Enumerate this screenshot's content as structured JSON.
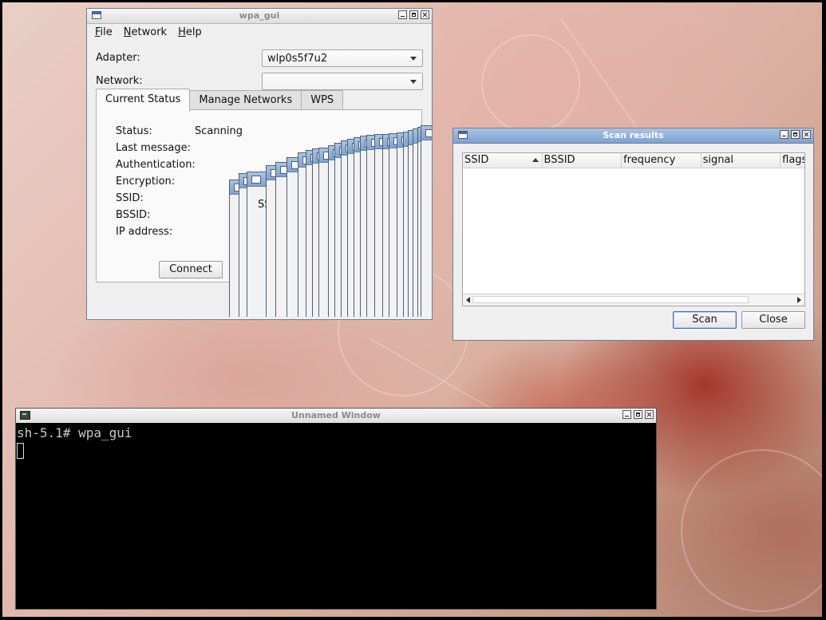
{
  "wpa_gui": {
    "title": "wpa_gui",
    "menu": [
      "File",
      "Network",
      "Help"
    ],
    "adapter_label": "Adapter:",
    "adapter_value": "wlp0s5f7u2",
    "network_label": "Network:",
    "network_value": "",
    "tabs": [
      "Current Status",
      "Manage Networks",
      "WPS"
    ],
    "status_fields": [
      {
        "label": "Status:",
        "value": "Scanning"
      },
      {
        "label": "Last message:",
        "value": ""
      },
      {
        "label": "Authentication:",
        "value": ""
      },
      {
        "label": "Encryption:",
        "value": ""
      },
      {
        "label": "SSID:",
        "value": ""
      },
      {
        "label": "BSSID:",
        "value": ""
      },
      {
        "label": "IP address:",
        "value": ""
      }
    ],
    "connect_label": "Connect",
    "cascade_fragment_text": "SS"
  },
  "scan_results": {
    "title": "Scan results",
    "columns": [
      "SSID",
      "BSSID",
      "frequency",
      "signal",
      "flags"
    ],
    "rows": [],
    "scan_label": "Scan",
    "close_label": "Close"
  },
  "terminal": {
    "title": "Unnamed Window",
    "prompt_line": "sh-5.1# wpa_gui"
  }
}
